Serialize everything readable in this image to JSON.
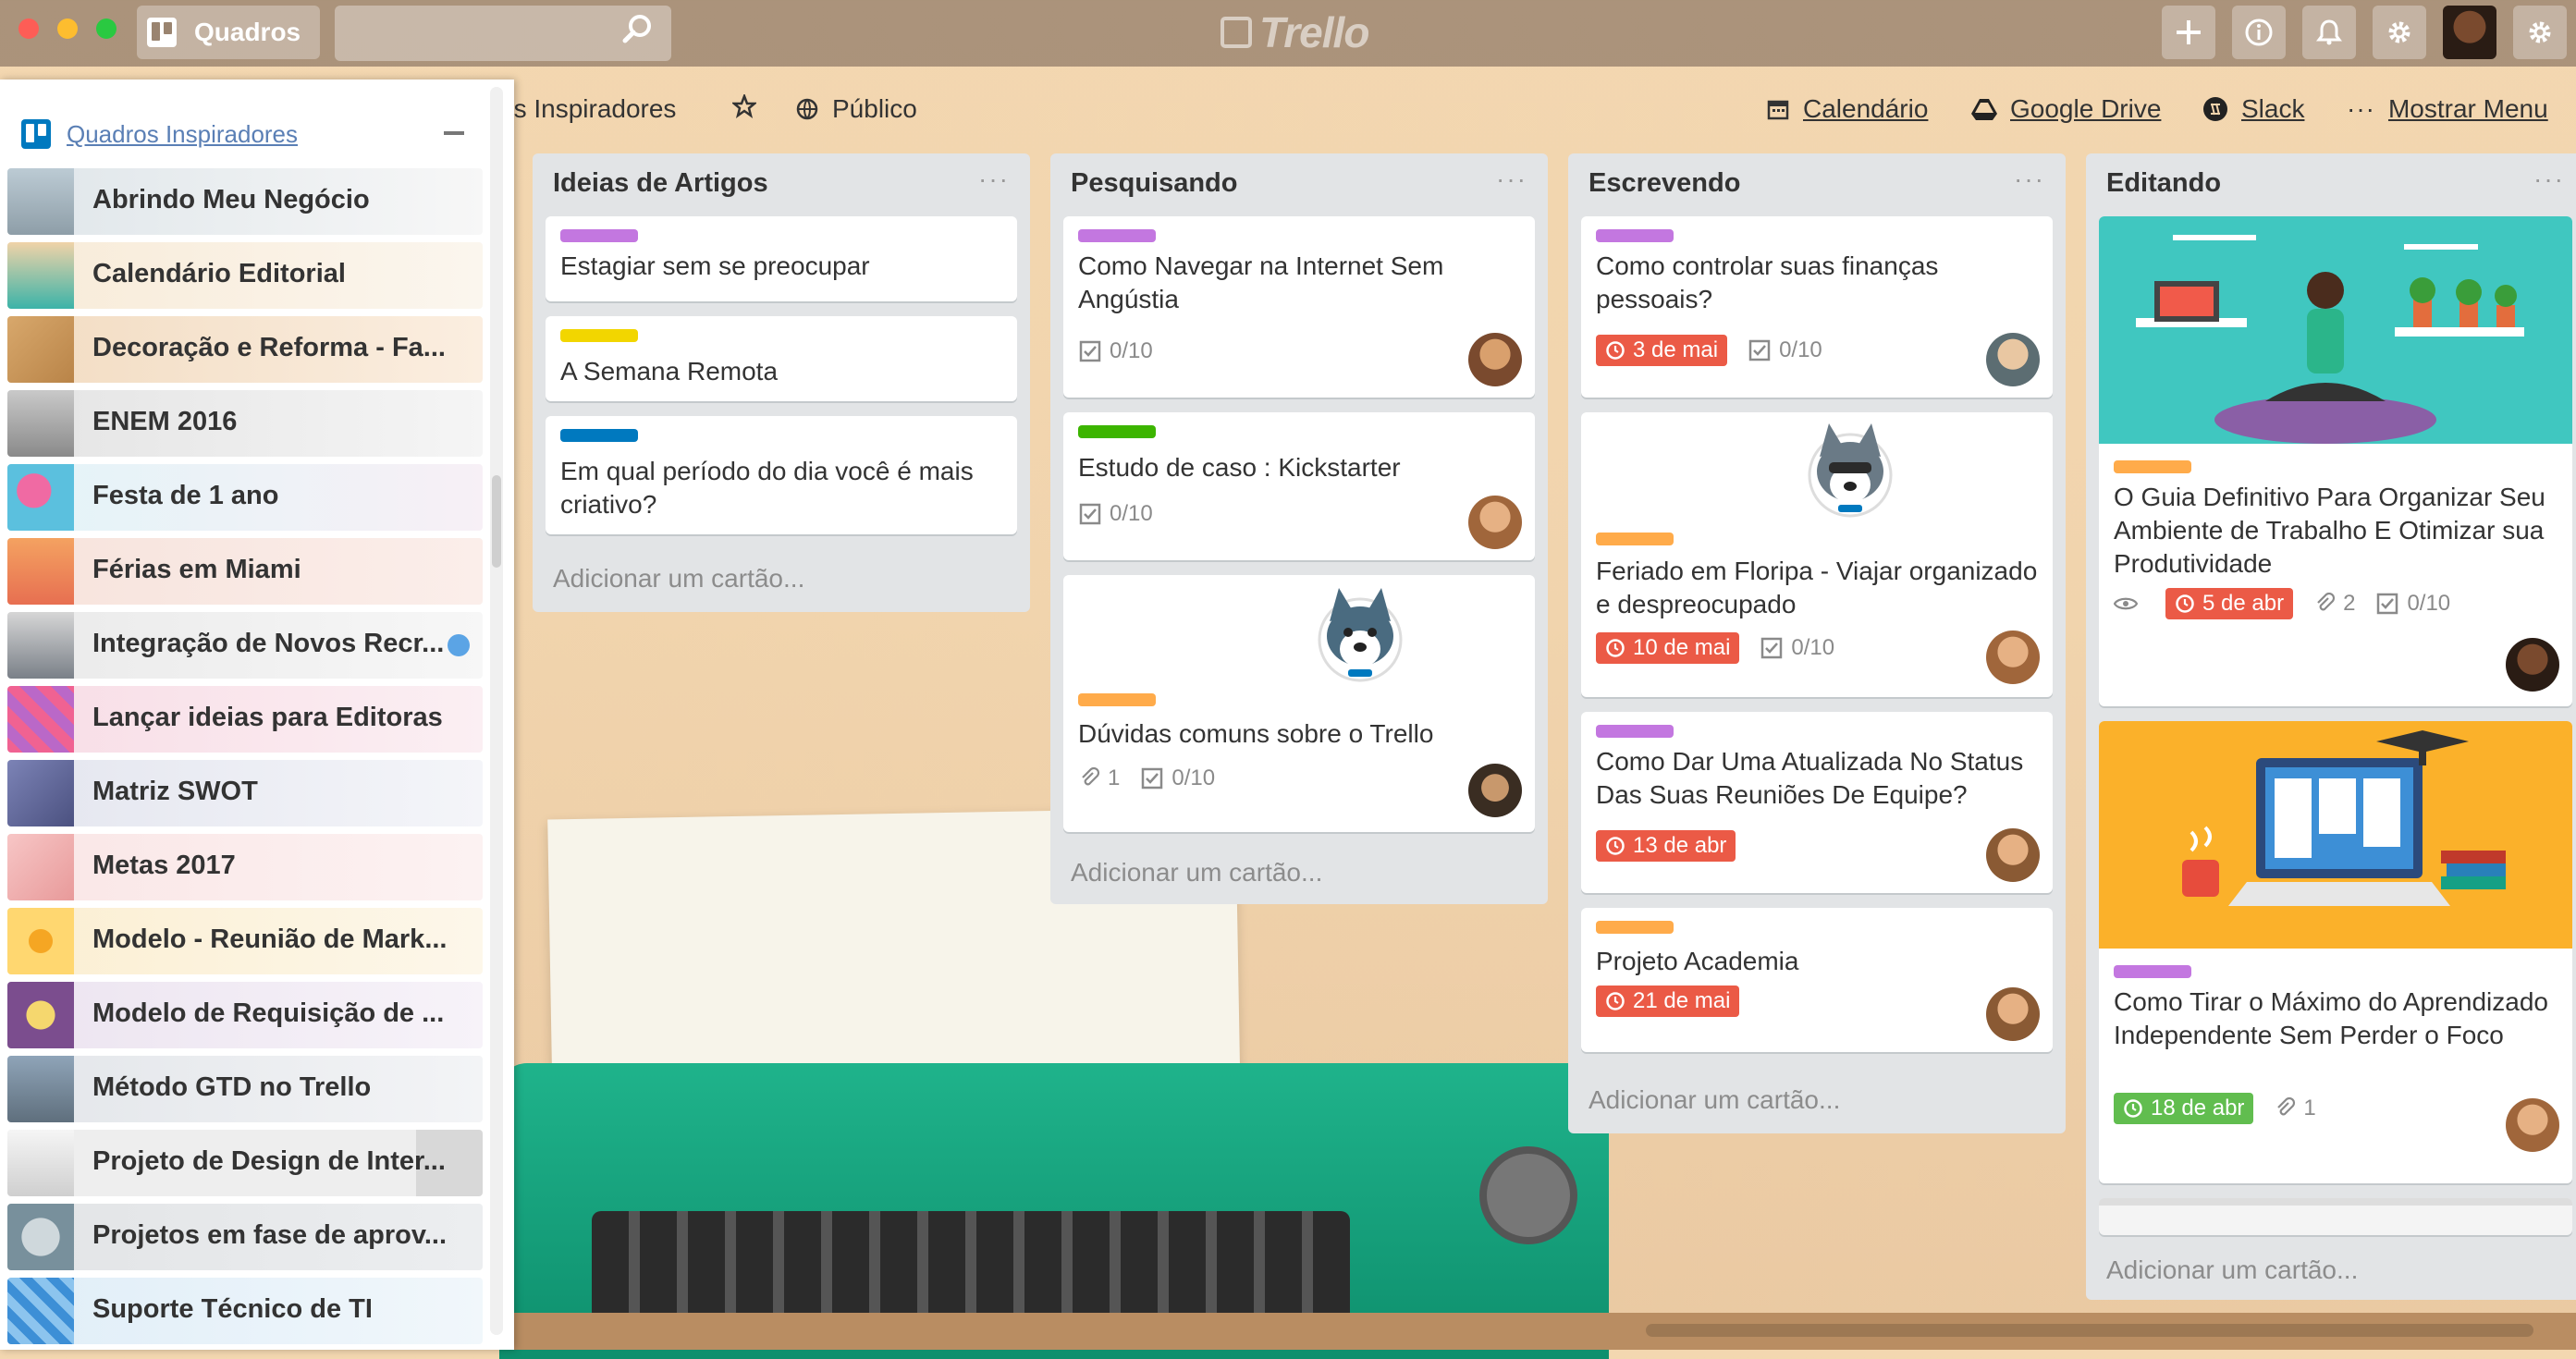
{
  "header": {
    "boards_label": "Quadros",
    "logo_text": "Trello",
    "search_value": ""
  },
  "board": {
    "name_partial": "os Inspiradores",
    "visibility": "Público",
    "powerups": {
      "calendar": "Calendário",
      "drive": "Google Drive",
      "slack": "Slack",
      "menu": "Mostrar Menu"
    }
  },
  "sidebar": {
    "title": "Quadros Inspiradores",
    "items": [
      {
        "label": "Abrindo Meu Negócio"
      },
      {
        "label": "Calendário Editorial"
      },
      {
        "label": "Decoração e Reforma - Fa..."
      },
      {
        "label": "ENEM 2016"
      },
      {
        "label": "Festa de 1 ano"
      },
      {
        "label": "Férias em Miami"
      },
      {
        "label": "Integração de Novos Recr..."
      },
      {
        "label": "Lançar ideias para Editoras"
      },
      {
        "label": "Matriz SWOT"
      },
      {
        "label": "Metas 2017"
      },
      {
        "label": "Modelo - Reunião de Mark..."
      },
      {
        "label": "Modelo de Requisição de ..."
      },
      {
        "label": "Método GTD no Trello"
      },
      {
        "label": "Projeto de Design de Inter..."
      },
      {
        "label": "Projetos em fase de aprov..."
      },
      {
        "label": "Suporte Técnico de TI"
      }
    ]
  },
  "lists": [
    {
      "title": "Ideias de Artigos",
      "cards": [
        {
          "label_color": "#c377e0",
          "text": "Estagiar sem se preocupar"
        },
        {
          "label_color": "#f2d600",
          "text": "A Semana Remota"
        },
        {
          "label_color": "#0079bf",
          "text": "Em qual período do dia você é mais criativo?"
        }
      ],
      "add_card": "Adicionar um cartão..."
    },
    {
      "title": "Pesquisando",
      "cards": [
        {
          "label_color": "#c377e0",
          "text": "Como Navegar na Internet Sem Angústia",
          "checklist": "0/10"
        },
        {
          "label_color": "#3cb500",
          "text": "Estudo de caso : Kickstarter",
          "checklist": "0/10"
        },
        {
          "label_color": "#ffab4a",
          "text": "Dúvidas comuns sobre o Trello",
          "attachments": "1",
          "checklist": "0/10"
        }
      ],
      "add_card": "Adicionar um cartão..."
    },
    {
      "title": "Escrevendo",
      "cards": [
        {
          "label_color": "#c377e0",
          "text": "Como controlar suas finanças pessoais?",
          "due": "3 de mai",
          "checklist": "0/10"
        },
        {
          "label_color": "#ffab4a",
          "text": "Feriado em Floripa - Viajar organizado e despreocupado",
          "due": "10 de mai",
          "checklist": "0/10"
        },
        {
          "label_color": "#c377e0",
          "text": "Como Dar Uma Atualizada No Status Das Suas Reuniões De Equipe?",
          "due": "13 de abr"
        },
        {
          "label_color": "#ffab4a",
          "text": "Projeto Academia",
          "due": "21 de mai"
        }
      ],
      "add_card": "Adicionar um cartão..."
    },
    {
      "title": "Editando",
      "cards": [
        {
          "label_color": "#ffab4a",
          "text": "O Guia Definitivo Para Organizar Seu Ambiente de Trabalho E Otimizar sua Produtividade",
          "due": "5 de abr",
          "attachments": "2",
          "checklist": "0/10"
        },
        {
          "label_color": "#c377e0",
          "text": "Como Tirar o Máximo do Aprendizado Independente Sem Perder o Foco",
          "due": "18 de abr",
          "attachments": "1"
        }
      ],
      "add_card": "Adicionar um cartão..."
    }
  ],
  "colors": {
    "due_overdue": "#eb5a46",
    "due_complete": "#61bd4f",
    "list_bg": "#e2e4e6"
  }
}
